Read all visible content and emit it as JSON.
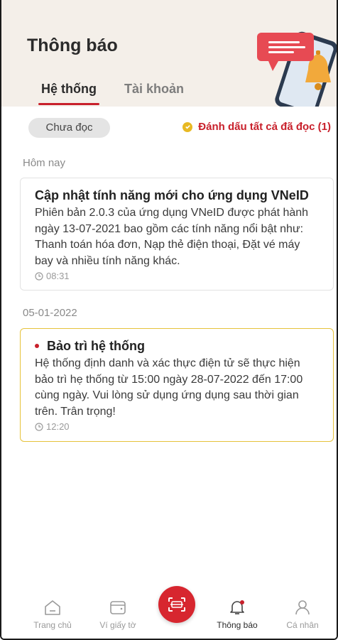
{
  "header": {
    "title": "Thông báo",
    "tabs": [
      {
        "label": "Hệ thống",
        "active": true
      },
      {
        "label": "Tài khoản",
        "active": false
      }
    ]
  },
  "filter": {
    "chip_label": "Chưa đọc",
    "mark_all_label": "Đánh dấu tất cả đã đọc (1)"
  },
  "sections": [
    {
      "date": "Hôm nay",
      "items": [
        {
          "title": "Cập nhật tính năng mới cho ứng dụng VNeID",
          "body": "Phiên bản 2.0.3 của ứng dụng VNeID được phát hành ngày 13-07-2021 bao gồm các tính năng nổi bật như: Thanh toán hóa đơn, Nạp thẻ điện thoại, Đặt vé máy bay và nhiều tính năng khác.",
          "time": "08:31",
          "unread": false
        }
      ]
    },
    {
      "date": "05-01-2022",
      "items": [
        {
          "title": "Bảo trì hệ thống",
          "body": "Hệ thống định danh và xác thực điện tử sẽ thực hiện bảo trì hẹ thống từ 15:00 ngày 28-07-2022 đến 17:00 cùng ngày. Vui lòng sử dụng ứng dụng sau thời gian trên. Trân trọng!",
          "time": "12:20",
          "unread": true
        }
      ]
    }
  ],
  "bottom_nav": {
    "home": "Trang chủ",
    "wallet": "Ví giấy tờ",
    "notifications": "Thông báo",
    "profile": "Cá nhân"
  },
  "colors": {
    "accent": "#c8202b",
    "unread_border": "#e6c23a",
    "header_bg": "#f4efe9"
  }
}
